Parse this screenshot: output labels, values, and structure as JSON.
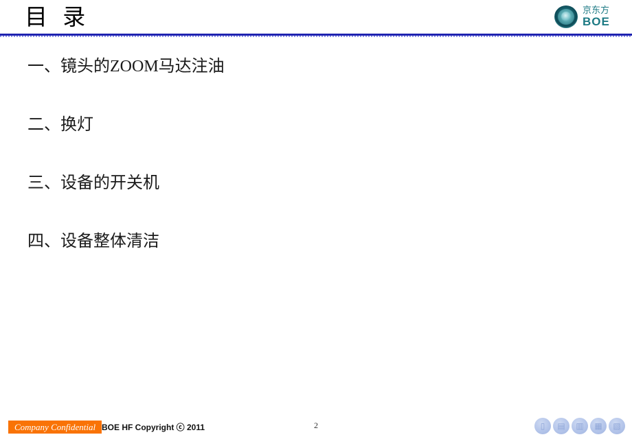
{
  "slide": {
    "title": "目 录",
    "page_number": "2",
    "background_color": "#ffffff",
    "rule_color": "#1f23b0"
  },
  "logo": {
    "name": "boe-logo",
    "chinese": "京东方",
    "english": "BOE",
    "color": "#1d7a84"
  },
  "toc": {
    "items": [
      {
        "label": "一、镜头的ZOOM马达注油"
      },
      {
        "label": "二、换灯"
      },
      {
        "label": "三、设备的开关机"
      },
      {
        "label": "四、设备整体清洁"
      }
    ]
  },
  "footer": {
    "confidential_label": "Company Confidential",
    "confidential_bg": "#f97306",
    "copyright": "BOE HF  Copyright ⓒ 2011",
    "icons": [
      {
        "name": "footer-badge-icon-1",
        "glyph": "▯"
      },
      {
        "name": "footer-badge-icon-2",
        "glyph": "▤"
      },
      {
        "name": "footer-badge-icon-3",
        "glyph": "▥"
      },
      {
        "name": "footer-badge-icon-4",
        "glyph": "▦"
      },
      {
        "name": "footer-badge-icon-5",
        "glyph": "▧"
      }
    ]
  }
}
